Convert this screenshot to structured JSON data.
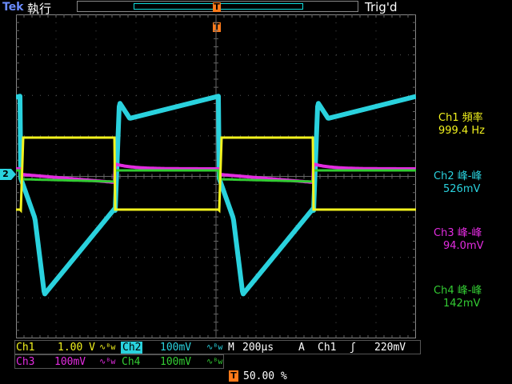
{
  "brand": "Tek",
  "acq_status": "執行",
  "trigger_status": "Trig'd",
  "trigger_marker": "T",
  "colors": {
    "ch1": "#f2f21e",
    "ch2": "#2ad2de",
    "ch3": "#e32ce0",
    "ch4": "#33cc33",
    "grid": "#3a3a3a",
    "frame": "#888888",
    "orange": "#ff7a1a"
  },
  "ch2_ground_marker": "2",
  "measurements": [
    {
      "title": "Ch1 頻率",
      "value": "999.4 Hz",
      "color": "#f2f21e"
    },
    {
      "title": "Ch2 峰-峰",
      "value": "526mV",
      "color": "#2ad2de"
    },
    {
      "title": "Ch3 峰-峰",
      "value": "94.0mV",
      "color": "#e32ce0"
    },
    {
      "title": "Ch4 峰-峰",
      "value": "142mV",
      "color": "#33cc33"
    }
  ],
  "bottom": {
    "ch1_label": "Ch1",
    "ch1_scale": "1.00 V",
    "ch2_label": "Ch2",
    "ch2_scale": "100mV",
    "ch3_label": "Ch3",
    "ch3_scale": "100mV",
    "ch4_label": "Ch4",
    "ch4_scale": "100mV",
    "coupling_icon": "∿ᴮw",
    "timebase_label": "M",
    "timebase_value": "200µs",
    "trigger_label": "A",
    "trigger_source": "Ch1",
    "trigger_slope": "ʃ",
    "trigger_level": "220mV",
    "trigger_position_icon": "T",
    "trigger_position": "50.00 %"
  }
}
